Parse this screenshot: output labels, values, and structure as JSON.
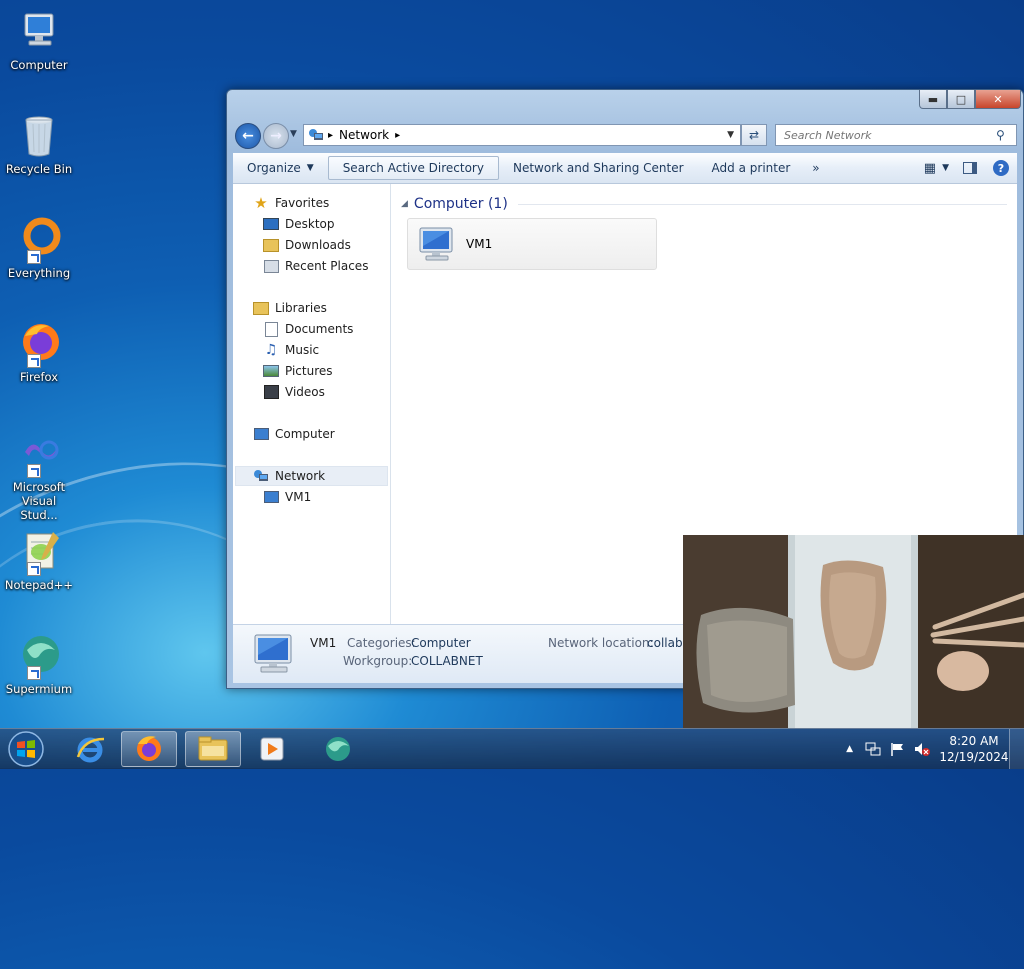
{
  "desktop": {
    "icons": [
      {
        "label": "Computer"
      },
      {
        "label": "Recycle Bin"
      },
      {
        "label": "Everything"
      },
      {
        "label": "Firefox"
      },
      {
        "label": "Microsoft Visual Stud..."
      },
      {
        "label": "Notepad++"
      },
      {
        "label": "Supermium"
      }
    ]
  },
  "window": {
    "address": {
      "root_arrow": "▸",
      "location": "Network",
      "trail_arrow": "▸"
    },
    "search": {
      "placeholder": "Search Network"
    },
    "toolbar": {
      "organize": "Organize",
      "search_ad": "Search Active Directory",
      "network_sharing": "Network and Sharing Center",
      "add_printer": "Add a printer",
      "more": "»"
    },
    "nav": {
      "favorites": "Favorites",
      "desktop": "Desktop",
      "downloads": "Downloads",
      "recent": "Recent Places",
      "libraries": "Libraries",
      "documents": "Documents",
      "music": "Music",
      "pictures": "Pictures",
      "videos": "Videos",
      "computer": "Computer",
      "network": "Network",
      "vm1": "VM1"
    },
    "group": {
      "header": "Computer (1)"
    },
    "items": [
      {
        "name": "VM1"
      }
    ],
    "details": {
      "name": "VM1",
      "categories_label": "Categories:",
      "categories_value": "Computer",
      "workgroup_label": "Workgroup:",
      "workgroup_value": "COLLABNET",
      "location_label": "Network location:",
      "location_value": "collabn"
    }
  },
  "taskbar": {
    "clock": {
      "time": "8:20 AM",
      "date": "12/19/2024"
    }
  },
  "colors": {
    "accent": "#1e395b",
    "group_header": "#1e3287",
    "taskbar": "#1c3f6b"
  }
}
